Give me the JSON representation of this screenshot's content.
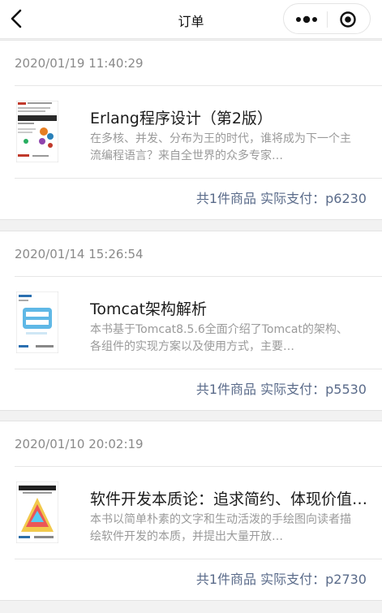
{
  "nav": {
    "title": "订单"
  },
  "orders": [
    {
      "date": "2020/01/19 11:40:29",
      "title": "Erlang程序设计（第2版）",
      "desc": "在多核、并发、分布为王的时代，谁将成为下一个主流编程语言？来自全世界的众多专家…",
      "total": "共1件商品 实际支付：p6230",
      "cover_text": "Erlang程序设计"
    },
    {
      "date": "2020/01/14 15:26:54",
      "title": "Tomcat架构解析",
      "desc": "本书基于Tomcat8.5.6全面介绍了Tomcat的架构、各组件的实现方案以及使用方式，主要…",
      "total": "共1件商品 实际支付：p5530",
      "cover_text": "Tomcat 架构解析"
    },
    {
      "date": "2020/01/10 20:02:19",
      "title": "软件开发本质论：追求简约、体现价值、逐步构建",
      "desc": "本书以简单朴素的文字和生动活泼的手绘图向读者描绘软件开发的本质，并提出大量开放…",
      "total": "共1件商品 实际支付：p2730",
      "cover_text": "软件开发本质论"
    }
  ]
}
